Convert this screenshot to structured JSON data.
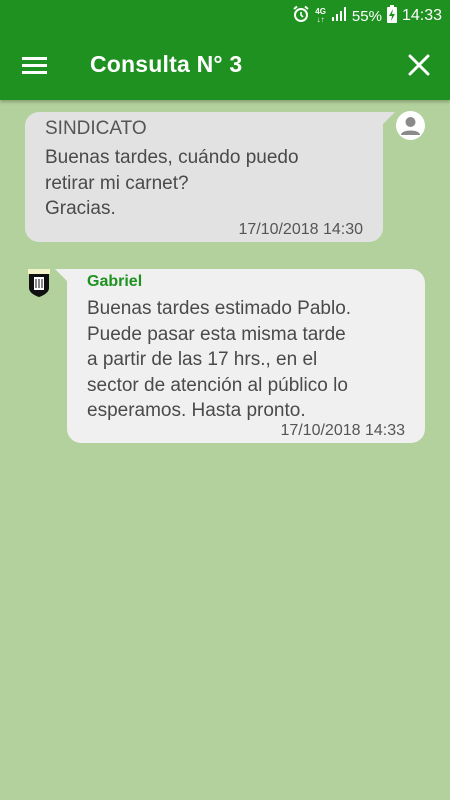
{
  "status_bar": {
    "network_top": "4G",
    "network_bottom": "↓↑",
    "battery": "55%",
    "time": "14:33",
    "icons": [
      "alarm-clock-icon",
      "signal-icon",
      "battery-charging-icon"
    ]
  },
  "toolbar": {
    "title": "Consulta N° 3",
    "menu_icon": "hamburger-menu-icon",
    "close_icon": "close-icon",
    "background": "#1e9121"
  },
  "messages": [
    {
      "sender": "SINDICATO",
      "lines": [
        "Buenas tardes, cuándo puedo",
        "retirar mi carnet?",
        "Gracias."
      ],
      "timestamp": "17/10/2018 14:30",
      "avatar_icon": "user-avatar-icon"
    },
    {
      "sender": "Gabriel",
      "lines": [
        "Buenas tardes estimado Pablo.",
        "Puede pasar esta misma tarde",
        "a partir de las 17 hrs., en el",
        "sector de atención al público lo",
        "esperamos. Hasta pronto."
      ],
      "timestamp": "17/10/2018 14:33",
      "avatar_icon": "union-logo-icon"
    }
  ],
  "colors": {
    "chat_background": "#b3d19c",
    "incoming_bubble": "#e2e2e2",
    "outgoing_bubble": "#f0f0f0",
    "accent": "#1e9121"
  }
}
